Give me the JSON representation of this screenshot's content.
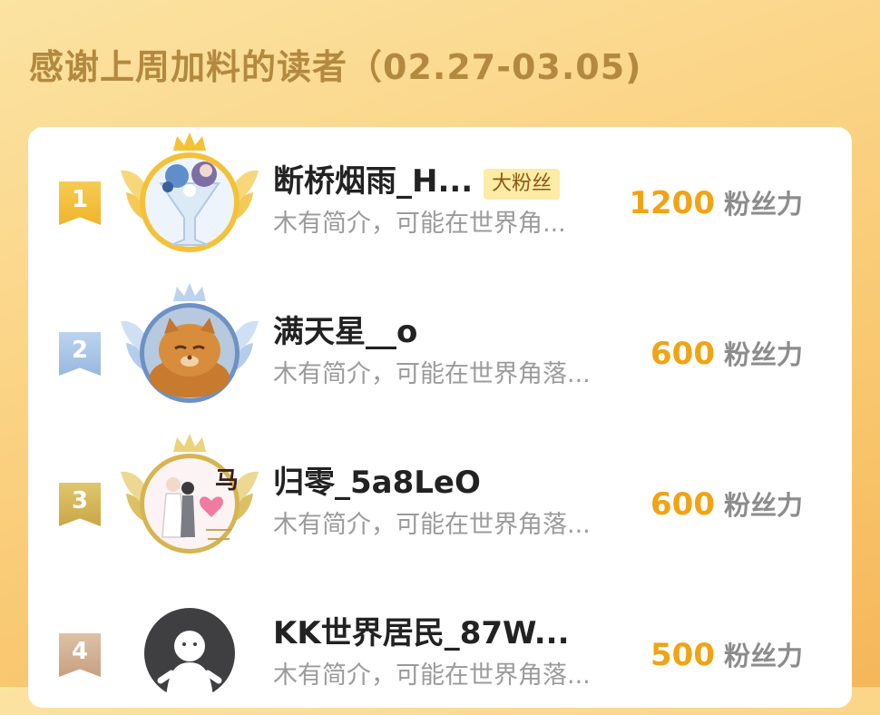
{
  "header": {
    "title": "感谢上周加料的读者（02.27-03.05)"
  },
  "readers": [
    {
      "rank": "1",
      "name": "断桥烟雨_H...",
      "badge": "大粉丝",
      "intro": "木有简介，可能在世界角...",
      "score": "1200",
      "unit": "粉丝力",
      "avatar": "cocktail-girl-avatar"
    },
    {
      "rank": "2",
      "name": "满天星__o",
      "badge": "",
      "intro": "木有简介，可能在世界角落...",
      "score": "600",
      "unit": "粉丝力",
      "avatar": "orange-cat-avatar"
    },
    {
      "rank": "3",
      "name": "归零_5a8LeO",
      "badge": "",
      "intro": "木有简介，可能在世界角落...",
      "score": "600",
      "unit": "粉丝力",
      "avatar": "wedding-couple-avatar",
      "avatar_text": "马"
    },
    {
      "rank": "4",
      "name": "KK世界居民_87W...",
      "badge": "",
      "intro": "木有简介，可能在世界角落...",
      "score": "500",
      "unit": "粉丝力",
      "avatar": "default-ghost-avatar"
    }
  ],
  "colors": {
    "score": "#f0a415",
    "gold": "#f3c23a",
    "silver": "#a9c6ea",
    "bronze": "#d6b450"
  }
}
